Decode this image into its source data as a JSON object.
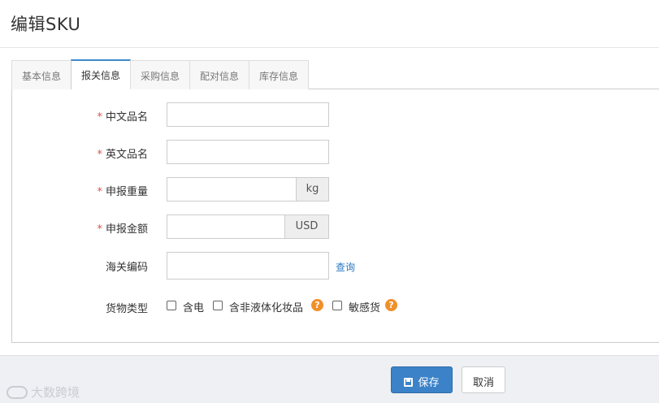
{
  "page": {
    "title": "编辑SKU"
  },
  "tabs": [
    {
      "label": "基本信息",
      "active": false
    },
    {
      "label": "报关信息",
      "active": true
    },
    {
      "label": "采购信息",
      "active": false
    },
    {
      "label": "配对信息",
      "active": false
    },
    {
      "label": "库存信息",
      "active": false
    }
  ],
  "form": {
    "required_mark": "*",
    "cn_name": {
      "label": "中文品名",
      "value": ""
    },
    "en_name": {
      "label": "英文品名",
      "value": ""
    },
    "weight": {
      "label": "申报重量",
      "value": "",
      "unit": "kg"
    },
    "amount": {
      "label": "申报金额",
      "value": "",
      "unit": "USD"
    },
    "hs_code": {
      "label": "海关编码",
      "value": "",
      "query_label": "查询"
    },
    "goods_type": {
      "label": "货物类型",
      "options": [
        {
          "label": "含电",
          "checked": false
        },
        {
          "label": "含非液体化妆品",
          "checked": false,
          "help": "?"
        },
        {
          "label": "敏感货",
          "checked": false,
          "help": "?"
        }
      ]
    }
  },
  "footer": {
    "save_label": "保存",
    "cancel_label": "取消"
  },
  "watermark": {
    "text": "大数跨境"
  },
  "colors": {
    "primary": "#3b82c8",
    "required": "#d9534f",
    "help": "#f0902a",
    "link": "#2a78c2"
  }
}
